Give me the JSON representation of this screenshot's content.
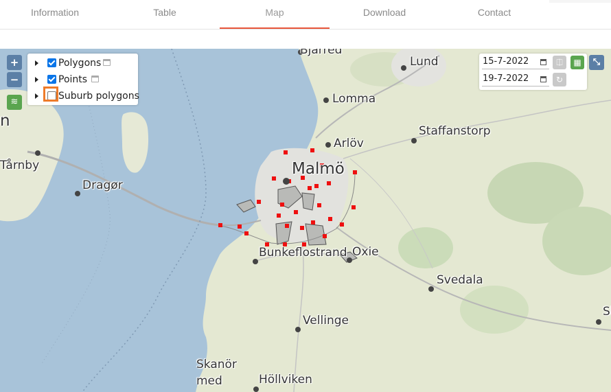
{
  "tabs": [
    {
      "label": "Information",
      "active": false
    },
    {
      "label": "Table",
      "active": false
    },
    {
      "label": "Map",
      "active": true
    },
    {
      "label": "Download",
      "active": false
    },
    {
      "label": "Contact",
      "active": false
    }
  ],
  "accent_color": "#e8553a",
  "map": {
    "places": {
      "bjarred": "Bjärred",
      "lund": "Lund",
      "lomma": "Lomma",
      "staffanstorp": "Staffanstorp",
      "arlov": "Arlöv",
      "malmo": "Malmö",
      "tarnby": "Tårnby",
      "dragor": "Dragør",
      "bunkeflostrand": "Bunkeflostrand",
      "oxie": "Oxie",
      "svedala": "Svedala",
      "vellinge": "Vellinge",
      "skanor": "Skanör",
      "skanor2": "med",
      "hollviken": "Höllviken",
      "cut_left": "n",
      "cut_right": "Sk"
    },
    "zoom_in_label": "+",
    "zoom_out_label": "−"
  },
  "layers": [
    {
      "label": "Polygons",
      "checked": true,
      "icon": "calendar-icon"
    },
    {
      "label": "Points",
      "checked": true,
      "icon": "calendar-icon"
    },
    {
      "label": "Suburb polygons",
      "checked": false,
      "highlighted": true
    }
  ],
  "date_filter": {
    "from": "15-7-2022",
    "to": "19-7-2022"
  },
  "icons": {
    "lock": "lock-icon",
    "calendar": "calendar-icon",
    "reset": "reset-icon",
    "expand": "expand-icon",
    "layers": "layers-icon"
  }
}
